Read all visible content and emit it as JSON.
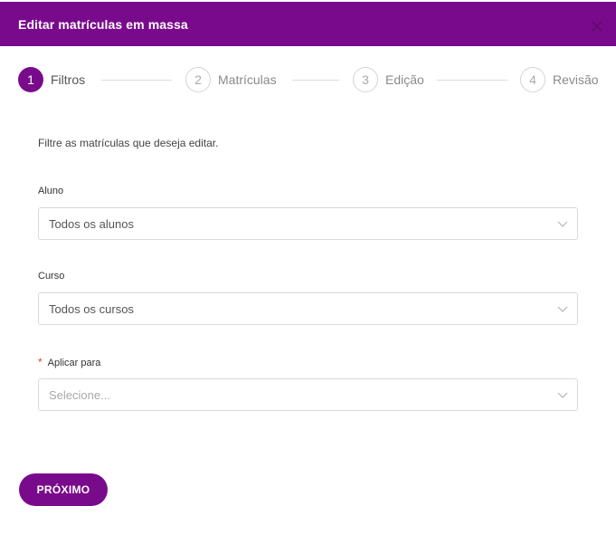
{
  "header": {
    "title": "Editar matrículas em massa",
    "close_icon": "close-icon"
  },
  "stepper": {
    "steps": [
      {
        "number": "1",
        "label": "Filtros",
        "active": true
      },
      {
        "number": "2",
        "label": "Matrículas",
        "active": false
      },
      {
        "number": "3",
        "label": "Edição",
        "active": false
      },
      {
        "number": "4",
        "label": "Revisão",
        "active": false
      }
    ]
  },
  "form": {
    "intro": "Filtre as matrículas que deseja editar.",
    "aluno": {
      "label": "Aluno",
      "value": "Todos os alunos"
    },
    "curso": {
      "label": "Curso",
      "value": "Todos os cursos"
    },
    "aplicar": {
      "label": "Aplicar para",
      "required_mark": "*",
      "placeholder": "Selecione..."
    }
  },
  "actions": {
    "next_label": "PRÓXIMO"
  },
  "colors": {
    "primary": "#7a0a8c",
    "required": "#e53935"
  }
}
